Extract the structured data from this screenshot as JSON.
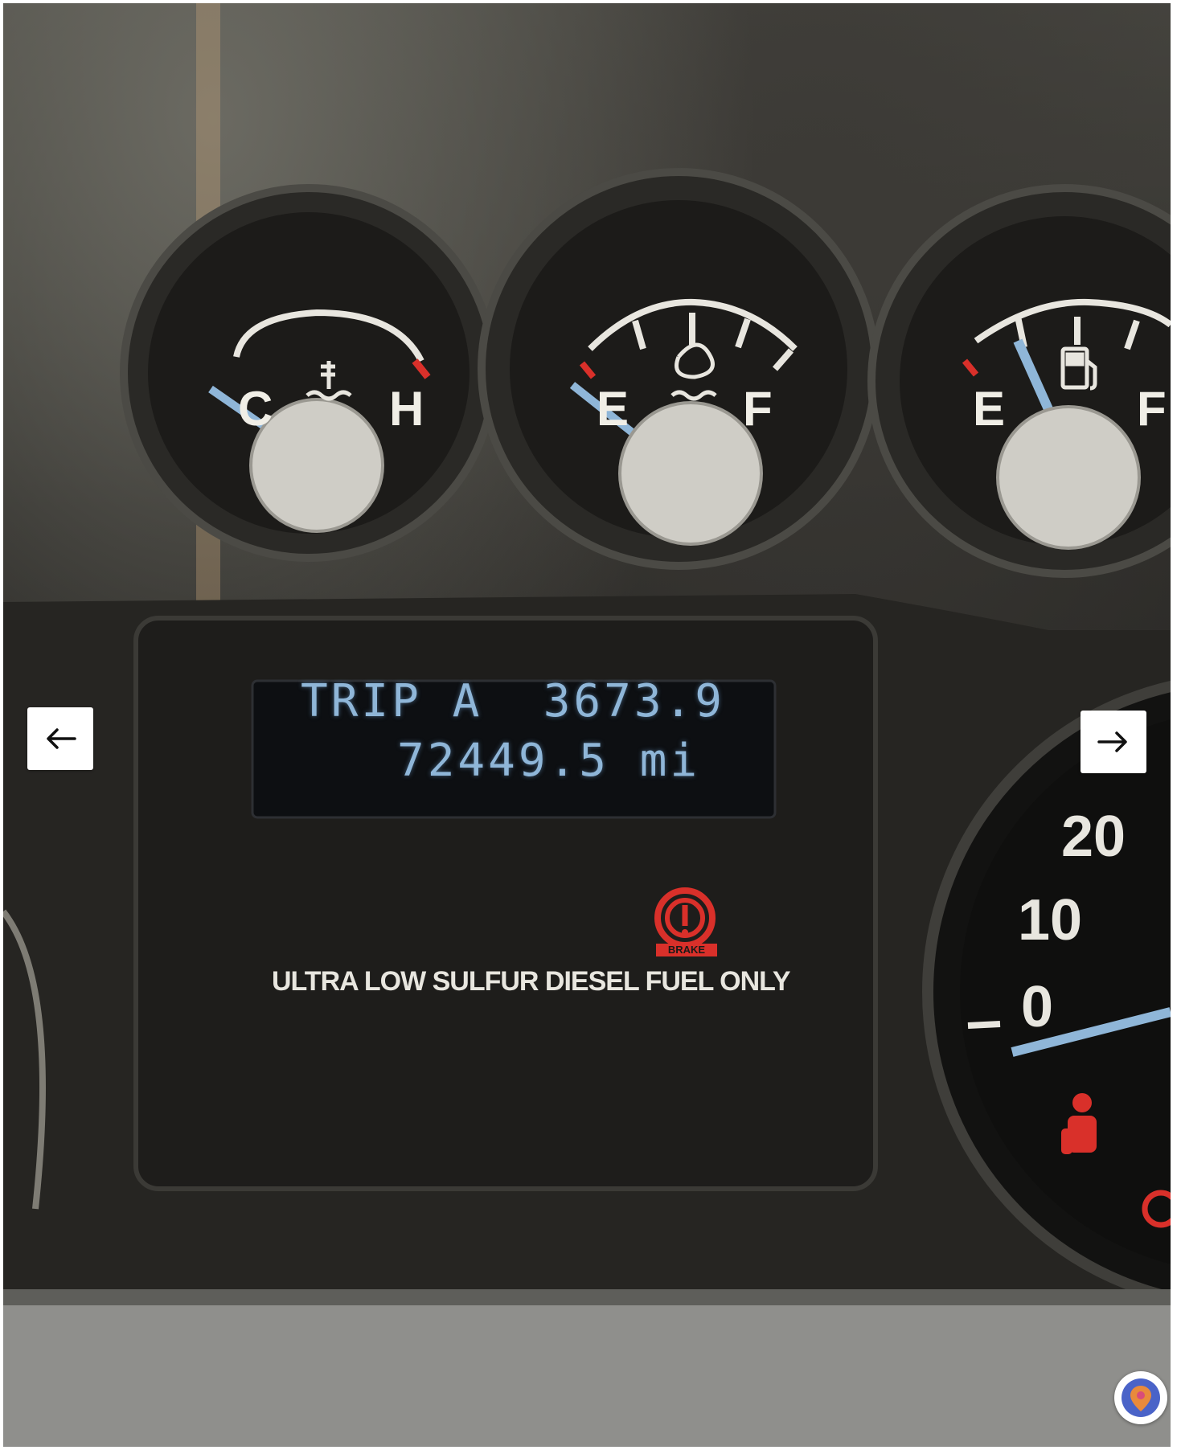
{
  "lcd": {
    "line1": "TRIP A  3673.9",
    "line2": "72449.5 mi"
  },
  "cluster": {
    "notice": "ULTRA LOW SULFUR DIESEL FUEL ONLY",
    "brake_label": "BRAKE"
  },
  "gauges": {
    "temperature": {
      "low": "C",
      "high": "H",
      "icon": "coolant-temperature-icon"
    },
    "def_level": {
      "low": "E",
      "high": "F",
      "icon": "diesel-exhaust-fluid-icon"
    },
    "fuel": {
      "low": "E",
      "high": "F",
      "icon": "fuel-pump-icon"
    }
  },
  "speedometer": {
    "labels": [
      "0",
      "10",
      "20"
    ]
  },
  "viewer": {
    "prev_icon": "arrow-left-icon",
    "next_icon": "arrow-right-icon",
    "badge_icon": "map-pin-icon"
  },
  "colors": {
    "lcd_text": "#8fb6d8",
    "warning_red": "#d9302a",
    "needle": "#8fb6d8"
  }
}
